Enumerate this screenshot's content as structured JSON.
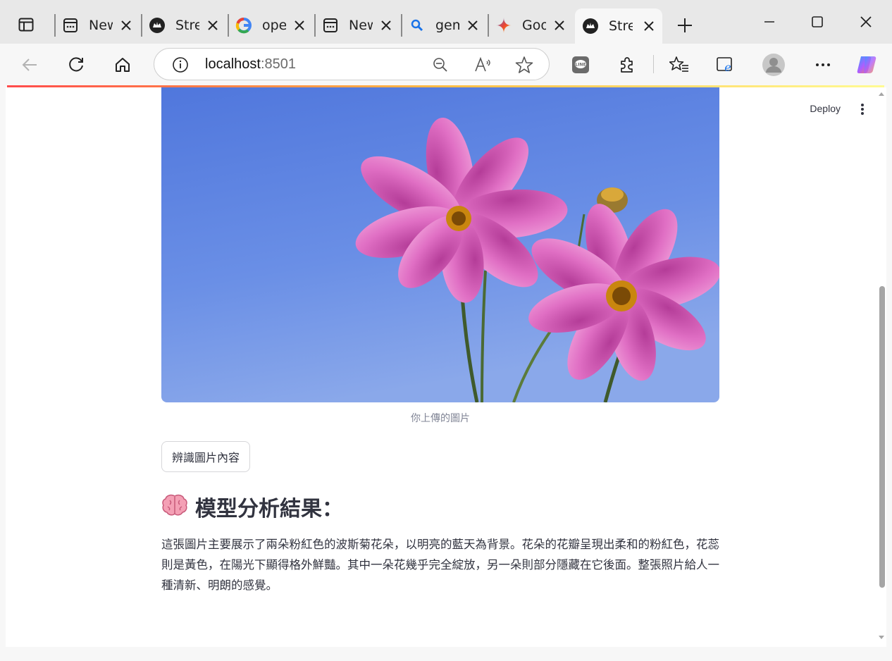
{
  "browser": {
    "tabs": [
      {
        "title": "New",
        "icon": "window-icon"
      },
      {
        "title": "Stre",
        "icon": "streamlit-icon"
      },
      {
        "title": "ope",
        "icon": "google-icon"
      },
      {
        "title": "New",
        "icon": "window-icon"
      },
      {
        "title": "gem",
        "icon": "search-icon"
      },
      {
        "title": "Goo",
        "icon": "gemini-icon"
      },
      {
        "title": "Stre",
        "icon": "streamlit-icon",
        "active": true
      }
    ],
    "address": {
      "host": "localhost",
      "port": ":8501"
    }
  },
  "app": {
    "deploy_label": "Deploy",
    "image_caption": "你上傳的圖片",
    "analyze_button": "辨識圖片內容",
    "result_emoji": "🧠",
    "result_heading": "模型分析結果：",
    "result_text": "這張圖片主要展示了兩朵粉紅色的波斯菊花朵，以明亮的藍天為背景。花朵的花瓣呈現出柔和的粉紅色，花蕊則是黃色，在陽光下顯得格外鮮豔。其中一朵花幾乎完全綻放，另一朵則部分隱藏在它後面。整張照片給人一種清新、明朗的感覺。"
  },
  "colors": {
    "accent_start": "#ff4b4b",
    "accent_end": "#fffb93",
    "sky": "#5b84e0",
    "petal": "#d85bb8"
  }
}
